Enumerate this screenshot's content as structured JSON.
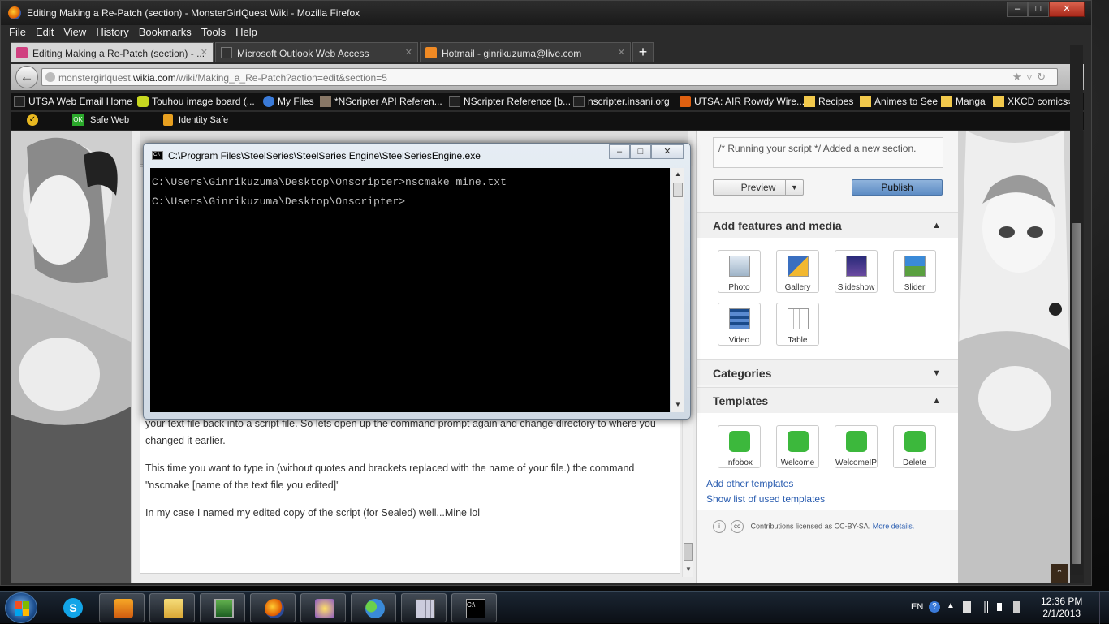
{
  "firefox": {
    "title": "Editing Making a Re-Patch (section) - MonsterGirlQuest Wiki - Mozilla Firefox",
    "menu": [
      "File",
      "Edit",
      "View",
      "History",
      "Bookmarks",
      "Tools",
      "Help"
    ],
    "tabs": [
      {
        "label": "Editing Making a Re-Patch (section) - ...",
        "active": true
      },
      {
        "label": "Microsoft Outlook Web Access",
        "active": false
      },
      {
        "label": "Hotmail - ginrikuzuma@live.com",
        "active": false
      }
    ],
    "url_prefix": "monstergirlquest.",
    "url_domain": "wikia.com",
    "url_path": "/wiki/Making_a_Re-Patch?action=edit&section=5",
    "bookmarks": [
      "UTSA Web Email Home",
      "Touhou image board (...",
      "My Files",
      "*NScripter API Referen...",
      "NScripter Reference [b...",
      "nscripter.insani.org",
      "UTSA: AIR Rowdy Wire...",
      "Recipes",
      "Animes to See",
      "Manga",
      "XKCD comics"
    ],
    "bookmarks_more": "»",
    "toolbar2": {
      "safe_web": "Safe Web",
      "identity_safe": "Identity Safe",
      "ok_badge": "OK"
    }
  },
  "editor": {
    "partial_letters": [
      "If",
      "pl",
      "tu",
      "th",
      "cl",
      "at",
      "an",
      "R",
      "S"
    ],
    "paragraphs": [
      "your text file back into a script file. So lets open up the command prompt again and change directory to where you",
      "changed it earlier.",
      "This time you want to type in (without quotes and brackets replaced with the name of your file.) the command",
      "\"nscmake [name of the text file you edited]\"",
      "In my case I named my edited copy of the script (for Sealed) well...Mine lol"
    ]
  },
  "rail": {
    "summary": "/* Running your script */ Added a new section.",
    "preview": "Preview",
    "publish": "Publish",
    "add_features": "Add features and media",
    "media_tools": [
      "Photo",
      "Gallery",
      "Slideshow",
      "Slider",
      "Video",
      "Table"
    ],
    "categories": "Categories",
    "templates": "Templates",
    "template_tools": [
      "Infobox",
      "Welcome",
      "WelcomeIP",
      "Delete"
    ],
    "add_other_templates": "Add other templates",
    "show_used_templates": "Show list of used templates",
    "license_text": "Contributions licensed as CC-BY-SA.",
    "license_link": "More details.",
    "cc_glyphs": [
      "i",
      "cc"
    ]
  },
  "cmd": {
    "title": "C:\\Program Files\\SteelSeries\\SteelSeries Engine\\SteelSeriesEngine.exe",
    "icon_text": "C:\\",
    "lines": [
      "C:\\Users\\Ginrikuzuma\\Desktop\\Onscripter>nscmake mine.txt",
      "C:\\Users\\Ginrikuzuma\\Desktop\\Onscripter>"
    ]
  },
  "taskbar": {
    "lang": "EN",
    "time": "12:36 PM",
    "date": "2/1/2013",
    "items": [
      "skype-icon",
      "media-player-icon",
      "explorer-icon",
      "monitor-icon",
      "firefox-icon",
      "game-icon",
      "messenger-icon",
      "calculator-icon",
      "cmd-icon"
    ]
  },
  "colors": {
    "publish": "#6f9bd0",
    "link": "#2a5db0",
    "console_bg": "#000000",
    "console_fg": "#c0c0c0"
  }
}
